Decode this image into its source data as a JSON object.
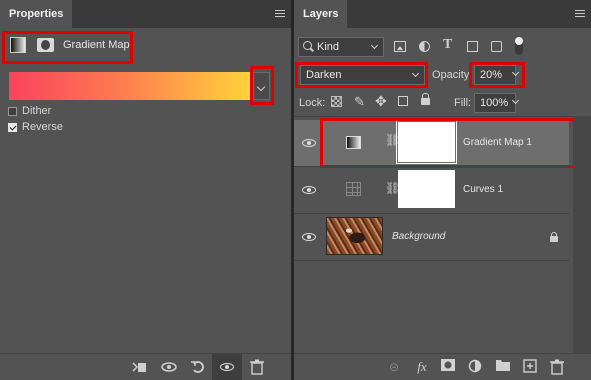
{
  "properties": {
    "tab_label": "Properties",
    "adjustment_name": "Gradient Map",
    "dither_label": "Dither",
    "dither_checked": false,
    "reverse_label": "Reverse",
    "reverse_checked": true,
    "gradient_colors": [
      "#f9435e",
      "#ff8a4c",
      "#ffd43a"
    ]
  },
  "layers": {
    "tab_label": "Layers",
    "filter_kind": "Kind",
    "blend_mode": "Darken",
    "opacity_label": "Opacity:",
    "opacity_value": "20%",
    "lock_label": "Lock:",
    "fill_label": "Fill:",
    "fill_value": "100%",
    "items": [
      {
        "name": "Gradient Map 1",
        "visible": true,
        "selected": true
      },
      {
        "name": "Curves 1",
        "visible": true,
        "selected": false
      },
      {
        "name": "Background",
        "visible": true,
        "selected": false,
        "locked": true
      }
    ]
  },
  "colors": {
    "panel_bg": "#535353",
    "tabbar_bg": "#3a3a3a",
    "selected_row": "#6e6e6e",
    "highlight_red": "#e00000"
  }
}
